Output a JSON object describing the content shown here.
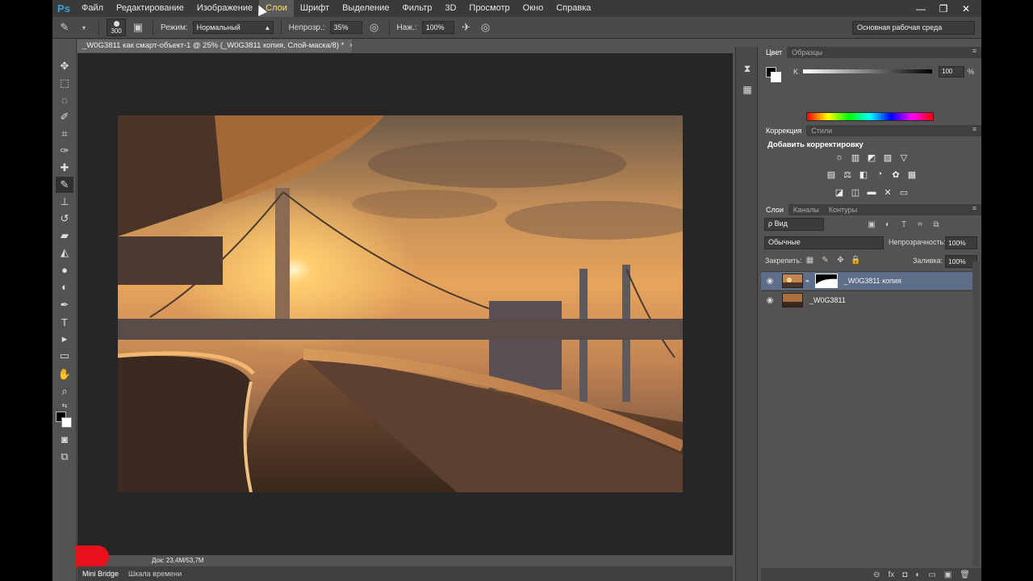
{
  "app": {
    "logo": "Ps",
    "menu": [
      "Файл",
      "Редактирование",
      "Изображение",
      "Слои",
      "Шрифт",
      "Выделение",
      "Фильтр",
      "3D",
      "Просмотр",
      "Окно",
      "Справка"
    ],
    "active_menu_index": 3,
    "window_controls": [
      "—",
      "❐",
      "✕"
    ]
  },
  "options_bar": {
    "brush_size": "300",
    "mode_label": "Режим:",
    "mode_value": "Нормальный",
    "opacity_label": "Непрозр.:",
    "opacity_value": "35%",
    "flow_label": "Наж.:",
    "flow_value": "100%",
    "workspace": "Основная рабочая среда"
  },
  "document": {
    "tab_title": "_W0G3811 как смарт-объект-1 @ 25% (_W0G3811 копия, Слой-маска/8) *",
    "status": "Док: 23,4M/53,7M"
  },
  "bottom_tabs": [
    "Mini Bridge",
    "Шкала времени"
  ],
  "panels": {
    "color": {
      "tabs": [
        "Цвет",
        "Образцы"
      ],
      "channel_label": "K",
      "channel_value": "100",
      "channel_unit": "%"
    },
    "adjustments": {
      "tabs": [
        "Коррекция",
        "Стили"
      ],
      "title": "Добавить корректировку",
      "row1": [
        "☼",
        "▥",
        "◩",
        "▨",
        "▽"
      ],
      "row2": [
        "▤",
        "⚖",
        "◧",
        "◔",
        "✿",
        "▦"
      ],
      "row3": [
        "◪",
        "◫",
        "▬",
        "✕",
        "▭"
      ]
    },
    "layers": {
      "tabs": [
        "Слои",
        "Каналы",
        "Контуры"
      ],
      "filter_label": "ρ Вид",
      "blend_mode": "Обычные",
      "opacity_label": "Непрозрачность:",
      "opacity_value": "100%",
      "lock_label": "Закрепить:",
      "fill_label": "Заливка:",
      "fill_value": "100%",
      "items": [
        {
          "name": "_W0G3811 копия",
          "selected": true
        },
        {
          "name": "_W0G3811",
          "selected": false
        }
      ],
      "bottom_icons": [
        "⊝",
        "fx",
        "◘",
        "◐",
        "▭",
        "▣",
        "🗑"
      ]
    }
  },
  "colors": {
    "menubar": "#3a3a3a",
    "panel": "#535353",
    "doc_bg": "#262626",
    "selected_layer": "#5e6e89",
    "record_badge": "#e8101a"
  }
}
